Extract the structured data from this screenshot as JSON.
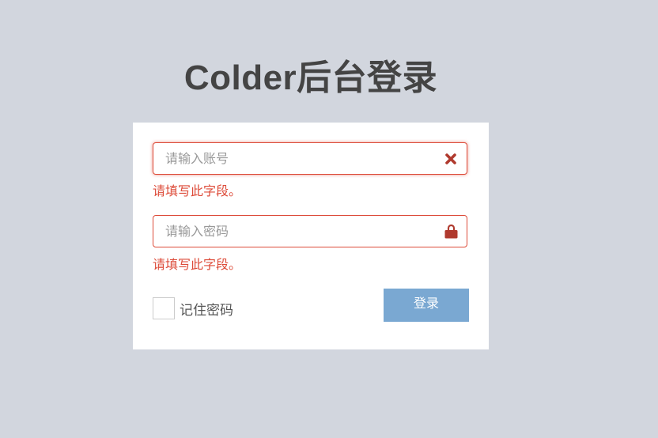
{
  "page": {
    "title": "Colder后台登录"
  },
  "form": {
    "username": {
      "placeholder": "请输入账号",
      "value": "",
      "icon": "close-icon",
      "error": "请填写此字段。"
    },
    "password": {
      "placeholder": "请输入密码",
      "value": "",
      "icon": "lock-icon",
      "error": "请填写此字段。"
    },
    "remember_label": "记住密码",
    "remember_checked": false,
    "submit_label": "登录"
  },
  "colors": {
    "background": "#d2d6de",
    "error": "#dd4b39",
    "button": "#7aa8d2",
    "title": "#444444"
  }
}
